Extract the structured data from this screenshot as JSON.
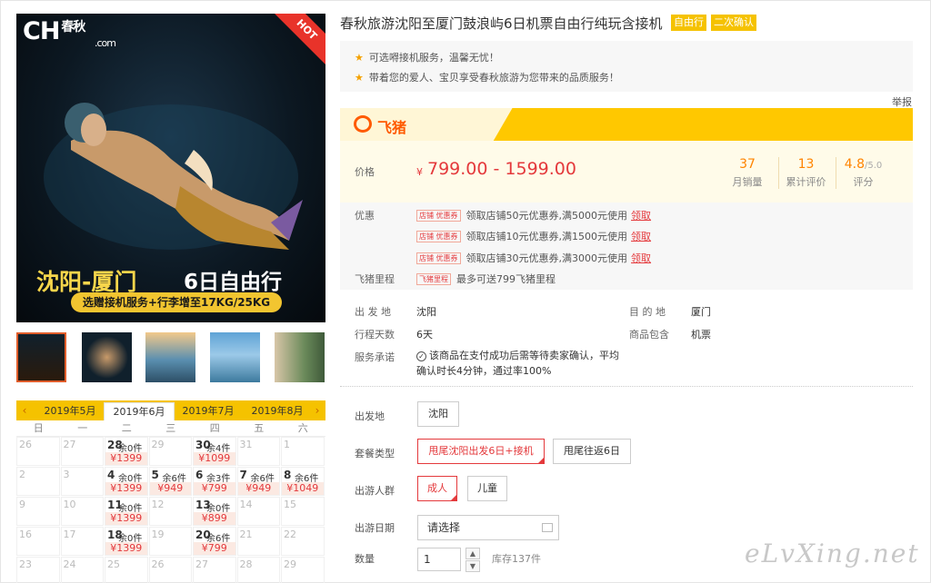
{
  "gallery": {
    "logo_main": "CH",
    "logo_cn": "春秋",
    "logo_domain": ".com",
    "hot_ribbon": "HOT",
    "hero_title": "沈阳-厦门",
    "hero_days": "6日自由行",
    "hero_subtitle": "选赠接机服务+行李增至17KG/25KG"
  },
  "calendar": {
    "prev_arrow": "‹",
    "next_arrow": "›",
    "months": [
      "2019年5月",
      "2019年6月",
      "2019年7月",
      "2019年8月"
    ],
    "active_month": "2019年6月",
    "weekdays": [
      "日",
      "一",
      "二",
      "三",
      "四",
      "五",
      "六"
    ],
    "days": [
      {
        "d": "26"
      },
      {
        "d": "27"
      },
      {
        "d": "28",
        "stock": "余0件",
        "price": "¥1399"
      },
      {
        "d": "29"
      },
      {
        "d": "30",
        "stock": "余4件",
        "price": "¥1099"
      },
      {
        "d": "31"
      },
      {
        "d": "1"
      },
      {
        "d": "2"
      },
      {
        "d": "3"
      },
      {
        "d": "4",
        "stock": "余0件",
        "price": "¥1399"
      },
      {
        "d": "5",
        "stock": "余6件",
        "price": "¥949"
      },
      {
        "d": "6",
        "stock": "余3件",
        "price": "¥799"
      },
      {
        "d": "7",
        "stock": "余6件",
        "price": "¥949"
      },
      {
        "d": "8",
        "stock": "余6件",
        "price": "¥1049"
      },
      {
        "d": "9"
      },
      {
        "d": "10"
      },
      {
        "d": "11",
        "stock": "余0件",
        "price": "¥1399"
      },
      {
        "d": "12"
      },
      {
        "d": "13",
        "stock": "余0件",
        "price": "¥899"
      },
      {
        "d": "14"
      },
      {
        "d": "15"
      },
      {
        "d": "16"
      },
      {
        "d": "17"
      },
      {
        "d": "18",
        "stock": "余0件",
        "price": "¥1399"
      },
      {
        "d": "19"
      },
      {
        "d": "20",
        "stock": "余6件",
        "price": "¥799"
      },
      {
        "d": "21"
      },
      {
        "d": "22"
      },
      {
        "d": "23"
      },
      {
        "d": "24"
      },
      {
        "d": "25"
      },
      {
        "d": "26"
      },
      {
        "d": "27"
      },
      {
        "d": "28"
      },
      {
        "d": "29"
      }
    ]
  },
  "product": {
    "title": "春秋旅游沈阳至厦门鼓浪屿6日机票自由行纯玩含接机",
    "tag1": "自由行",
    "tag2": "二次确认",
    "promo1": "可选嘚接机服务，温馨无忧！",
    "promo2": "带着您的爱人、宝贝享受春秋旅游为您带来的品质服务！",
    "report": "举报",
    "fliggy_logo": "飞猪"
  },
  "price": {
    "label": "价格",
    "currency": "¥",
    "range": "799.00 - 1599.00",
    "monthly_sales": "37",
    "monthly_sales_label": "月销量",
    "reviews": "13",
    "reviews_label": "累计评价",
    "score": "4.8",
    "score_max": "/5.0",
    "score_label": "评分"
  },
  "coupons": {
    "label": "优惠",
    "items": [
      {
        "tag": "店铺 优惠券",
        "text": "领取店铺50元优惠券,满5000元使用",
        "action": "领取"
      },
      {
        "tag": "店铺 优惠券",
        "text": "领取店铺10元优惠券,满1500元使用",
        "action": "领取"
      },
      {
        "tag": "店铺 优惠券",
        "text": "领取店铺30元优惠券,满3000元使用",
        "action": "领取"
      }
    ],
    "miles_label": "飞猪里程",
    "miles_tag": "飞猪里程",
    "miles_text": "最多可送799飞猪里程"
  },
  "info": {
    "depart_label": "出 发 地",
    "depart": "沈阳",
    "dest_label": "目 的 地",
    "dest": "厦门",
    "days_label": "行程天数",
    "days": "6天",
    "includes_label": "商品包含",
    "includes": "机票",
    "promise_label": "服务承诺",
    "promise_icon": "✓",
    "promise": "该商品在支付成功后需等待卖家确认，平均确认时长4分钟，通过率100%"
  },
  "options": {
    "depart_label": "出发地",
    "depart_value": "沈阳",
    "package_label": "套餐类型",
    "package_options": [
      "甩尾沈阳出发6日+接机",
      "甩尾往返6日"
    ],
    "travelers_label": "出游人群",
    "travelers_options": [
      "成人",
      "儿童"
    ],
    "date_label": "出游日期",
    "date_placeholder": "请选择",
    "qty_label": "数量",
    "qty_value": "1",
    "qty_up": "▲",
    "qty_down": "▼",
    "stock": "库存137件"
  },
  "watermark": "eLvXing.net",
  "colors": {
    "accent_red": "#e4393c",
    "fliggy_yellow": "#ffc800",
    "brand_orange": "#ff5a00"
  }
}
